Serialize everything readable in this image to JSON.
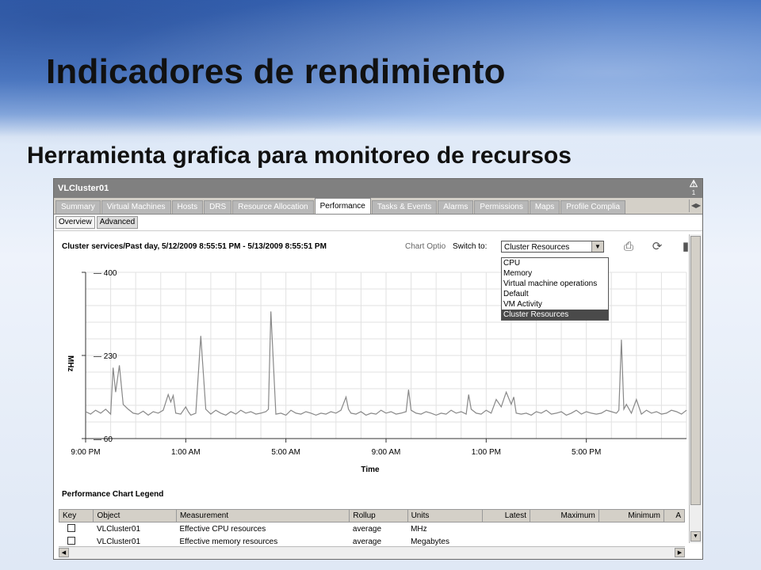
{
  "slide": {
    "title": "Indicadores de rendimiento",
    "subtitle": "Herramienta grafica para monitoreo de recursos"
  },
  "window": {
    "title": "VLCluster01",
    "alert_count": "1",
    "tabs": [
      "Summary",
      "Virtual Machines",
      "Hosts",
      "DRS",
      "Resource Allocation",
      "Performance",
      "Tasks & Events",
      "Alarms",
      "Permissions",
      "Maps",
      "Profile Complia"
    ],
    "active_tab": "Performance",
    "subtabs": [
      "Overview",
      "Advanced"
    ],
    "active_subtab": "Advanced"
  },
  "chart_panel": {
    "header": "Cluster services/Past day, 5/12/2009 8:55:51 PM - 5/13/2009 8:55:51 PM",
    "chart_options": "Chart Optio",
    "switch_to_label": "Switch to:",
    "selected": "Cluster Resources",
    "options": [
      "CPU",
      "Memory",
      "Virtual machine operations",
      "Default",
      "VM Activity",
      "Cluster Resources"
    ],
    "icons": [
      "print-icon",
      "refresh-icon",
      "popout-icon"
    ]
  },
  "chart_data": {
    "type": "line",
    "ylabel": "MHz",
    "xlabel": "Time",
    "y_ticks": [
      400,
      230,
      60
    ],
    "ylim": [
      60,
      400
    ],
    "x_ticks": [
      "9:00 PM",
      "1:00 AM",
      "5:00 AM",
      "9:00 AM",
      "1:00 PM",
      "5:00 PM"
    ],
    "xlim_hours": [
      0,
      24
    ],
    "series": [
      {
        "x": [
          0,
          0.2,
          0.4,
          0.6,
          0.8,
          1.0,
          1.1,
          1.2,
          1.35,
          1.5,
          1.7,
          1.9,
          2.1,
          2.3,
          2.5,
          2.7,
          2.9,
          3.1,
          3.3,
          3.4,
          3.5,
          3.6,
          3.8,
          4.0,
          4.1,
          4.2,
          4.4,
          4.6,
          4.8,
          5.0,
          5.2,
          5.4,
          5.6,
          5.8,
          6.0,
          6.2,
          6.4,
          6.6,
          6.8,
          7.0,
          7.2,
          7.3,
          7.4,
          7.6,
          7.8,
          8.0,
          8.2,
          8.4,
          8.6,
          8.8,
          9.0,
          9.2,
          9.4,
          9.6,
          9.8,
          10.0,
          10.2,
          10.4,
          10.5,
          10.6,
          10.8,
          11.0,
          11.2,
          11.4,
          11.6,
          11.8,
          12.0,
          12.2,
          12.4,
          12.6,
          12.8,
          12.9,
          13.0,
          13.2,
          13.4,
          13.6,
          13.8,
          14.0,
          14.2,
          14.4,
          14.6,
          14.8,
          15.0,
          15.2,
          15.3,
          15.4,
          15.6,
          15.8,
          16.0,
          16.2,
          16.4,
          16.6,
          16.8,
          17.0,
          17.1,
          17.2,
          17.4,
          17.6,
          17.8,
          18.0,
          18.2,
          18.4,
          18.6,
          18.8,
          19.0,
          19.2,
          19.4,
          19.6,
          19.8,
          20.0,
          20.2,
          20.4,
          20.6,
          20.8,
          21.0,
          21.2,
          21.3,
          21.4,
          21.5,
          21.6,
          21.8,
          22.0,
          22.2,
          22.4,
          22.6,
          22.8,
          23.0,
          23.2,
          23.4,
          23.6,
          23.8,
          24.0
        ],
        "y": [
          115,
          110,
          118,
          112,
          120,
          110,
          205,
          155,
          210,
          130,
          120,
          112,
          110,
          116,
          108,
          115,
          112,
          118,
          150,
          135,
          148,
          112,
          110,
          125,
          115,
          108,
          112,
          270,
          120,
          110,
          118,
          112,
          108,
          115,
          110,
          118,
          112,
          115,
          110,
          112,
          115,
          120,
          320,
          110,
          112,
          108,
          118,
          112,
          110,
          115,
          112,
          108,
          112,
          110,
          115,
          112,
          118,
          145,
          120,
          112,
          110,
          115,
          108,
          112,
          110,
          118,
          112,
          115,
          110,
          112,
          115,
          160,
          118,
          112,
          110,
          115,
          112,
          108,
          112,
          110,
          118,
          112,
          115,
          110,
          150,
          120,
          112,
          110,
          118,
          112,
          140,
          125,
          155,
          130,
          145,
          112,
          110,
          112,
          108,
          115,
          112,
          118,
          110,
          112,
          115,
          108,
          112,
          118,
          110,
          115,
          112,
          110,
          112,
          118,
          115,
          112,
          118,
          262,
          120,
          130,
          112,
          140,
          110,
          118,
          112,
          115,
          110,
          112,
          118,
          115,
          110,
          118
        ]
      }
    ]
  },
  "legend": {
    "title": "Performance Chart Legend",
    "columns": [
      "Key",
      "Object",
      "Measurement",
      "Rollup",
      "Units",
      "Latest",
      "Maximum",
      "Minimum",
      "A"
    ],
    "rows": [
      [
        "",
        "VLCluster01",
        "Effective CPU resources",
        "average",
        "MHz",
        "",
        "",
        "",
        ""
      ],
      [
        "",
        "VLCluster01",
        "Effective memory resources",
        "average",
        "Megabytes",
        "",
        "",
        "",
        ""
      ]
    ]
  }
}
